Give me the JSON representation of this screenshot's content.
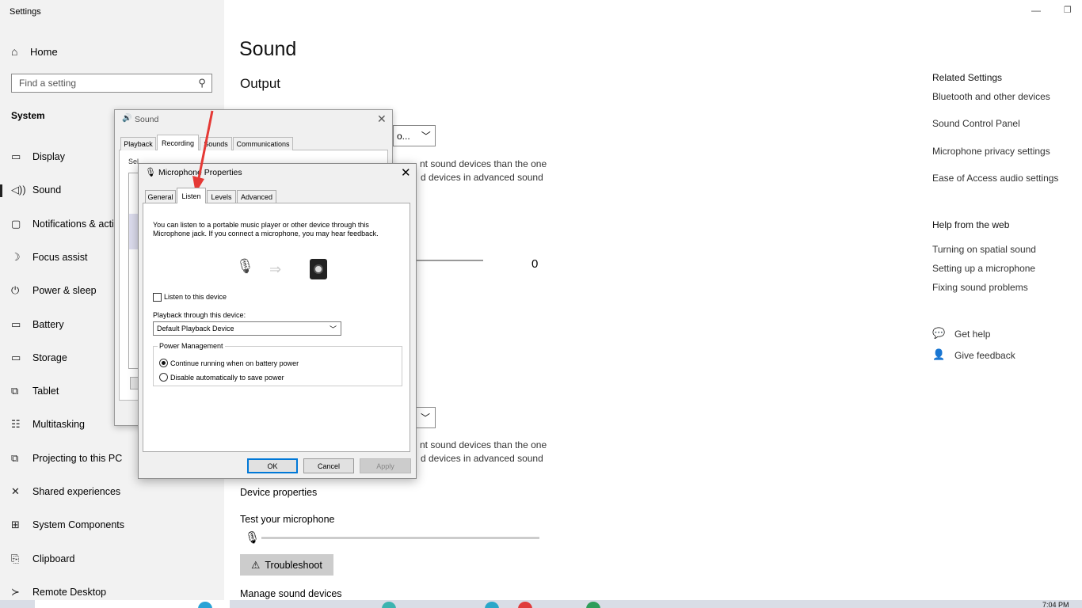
{
  "app_title": "Settings",
  "sidebar": {
    "home": {
      "label": "Home",
      "icon": "home-icon",
      "glyph": "⌂"
    },
    "search_placeholder": "Find a setting",
    "section": "System",
    "items": [
      {
        "label": "Display",
        "icon": "display-icon",
        "glyph": "▭"
      },
      {
        "label": "Sound",
        "icon": "speaker-icon",
        "glyph": "◁))"
      },
      {
        "label": "Notifications & acti",
        "icon": "notifications-icon",
        "glyph": "▢"
      },
      {
        "label": "Focus assist",
        "icon": "moon-icon",
        "glyph": "☽"
      },
      {
        "label": "Power & sleep",
        "icon": "power-icon",
        "glyph": "⏻"
      },
      {
        "label": "Battery",
        "icon": "battery-icon",
        "glyph": "▭"
      },
      {
        "label": "Storage",
        "icon": "storage-icon",
        "glyph": "▭"
      },
      {
        "label": "Tablet",
        "icon": "tablet-icon",
        "glyph": "⧉"
      },
      {
        "label": "Multitasking",
        "icon": "multitasking-icon",
        "glyph": "☷"
      },
      {
        "label": "Projecting to this PC",
        "icon": "projecting-icon",
        "glyph": "⧉"
      },
      {
        "label": "Shared experiences",
        "icon": "shared-icon",
        "glyph": "✕"
      },
      {
        "label": "System Components",
        "icon": "components-icon",
        "glyph": "⊞"
      },
      {
        "label": "Clipboard",
        "icon": "clipboard-icon",
        "glyph": "⎘"
      },
      {
        "label": "Remote Desktop",
        "icon": "remote-desktop-icon",
        "glyph": "≻"
      }
    ]
  },
  "main": {
    "title": "Sound",
    "output_heading": "Output",
    "dropdown1_text": "o...",
    "partial1a": "nt sound devices than the one",
    "partial1b": "d devices in advanced sound",
    "volume_value": "0",
    "partial2a": "nt sound devices than the one",
    "partial2b": "d devices in advanced sound",
    "device_properties": "Device properties",
    "test_mic": "Test your microphone",
    "troubleshoot": "Troubleshoot",
    "manage": "Manage sound devices"
  },
  "related": {
    "heading": "Related Settings",
    "links": [
      "Bluetooth and other devices",
      "Sound Control Panel",
      "Microphone privacy settings",
      "Ease of Access audio settings"
    ],
    "help_heading": "Help from the web",
    "help_links": [
      "Turning on spatial sound",
      "Setting up a microphone",
      "Fixing sound problems"
    ],
    "get_help": "Get help",
    "give_feedback": "Give feedback"
  },
  "sound_dialog": {
    "title": "Sound",
    "tabs": [
      "Playback",
      "Recording",
      "Sounds",
      "Communications"
    ],
    "partial_text": "Sel"
  },
  "mic_dialog": {
    "title": "Microphone Properties",
    "tabs": [
      "General",
      "Listen",
      "Levels",
      "Advanced"
    ],
    "selected_tab": "Listen",
    "description": "You can listen to a portable music player or other device through this Microphone jack.  If you connect a microphone, you may hear feedback.",
    "listen_checkbox": "Listen to this device",
    "listen_checked": false,
    "playback_label": "Playback through this device:",
    "playback_value": "Default Playback Device",
    "power_legend": "Power Management",
    "radio1": "Continue running when on battery power",
    "radio2": "Disable automatically to save power",
    "radio_selected": 1,
    "ok": "OK",
    "cancel": "Cancel",
    "apply": "Apply"
  },
  "taskbar": {
    "clock": "7:04 PM"
  },
  "colors": {
    "annotation": "#e53935",
    "focus": "#0078d7"
  }
}
